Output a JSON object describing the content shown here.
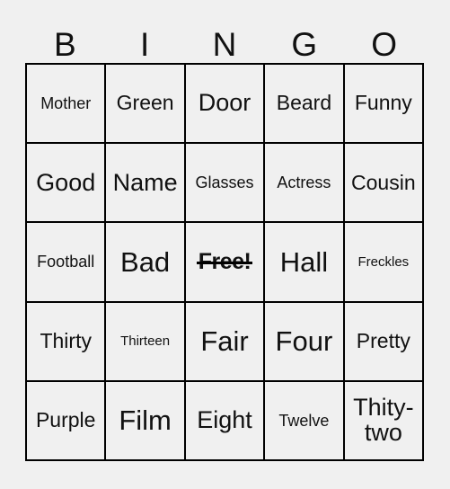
{
  "card": {
    "headers": [
      "B",
      "I",
      "N",
      "G",
      "O"
    ],
    "rows": [
      [
        {
          "label": "Mother",
          "size": "sm",
          "marked": false
        },
        {
          "label": "Green",
          "size": "md",
          "marked": false
        },
        {
          "label": "Door",
          "size": "lg",
          "marked": false
        },
        {
          "label": "Beard",
          "size": "md",
          "marked": false
        },
        {
          "label": "Funny",
          "size": "md",
          "marked": false
        }
      ],
      [
        {
          "label": "Good",
          "size": "lg",
          "marked": false
        },
        {
          "label": "Name",
          "size": "lg",
          "marked": false
        },
        {
          "label": "Glasses",
          "size": "sm",
          "marked": false
        },
        {
          "label": "Actress",
          "size": "sm",
          "marked": false
        },
        {
          "label": "Cousin",
          "size": "md",
          "marked": false
        }
      ],
      [
        {
          "label": "Football",
          "size": "sm",
          "marked": false
        },
        {
          "label": "Bad",
          "size": "xl",
          "marked": false
        },
        {
          "label": "Free!",
          "size": "free",
          "marked": true
        },
        {
          "label": "Hall",
          "size": "xl",
          "marked": false
        },
        {
          "label": "Freckles",
          "size": "xs",
          "marked": false
        }
      ],
      [
        {
          "label": "Thirty",
          "size": "md",
          "marked": false
        },
        {
          "label": "Thirteen",
          "size": "xs",
          "marked": false
        },
        {
          "label": "Fair",
          "size": "xl",
          "marked": false
        },
        {
          "label": "Four",
          "size": "xl",
          "marked": false
        },
        {
          "label": "Pretty",
          "size": "md",
          "marked": false
        }
      ],
      [
        {
          "label": "Purple",
          "size": "md",
          "marked": false
        },
        {
          "label": "Film",
          "size": "xl",
          "marked": false
        },
        {
          "label": "Eight",
          "size": "lg",
          "marked": false
        },
        {
          "label": "Twelve",
          "size": "sm",
          "marked": false
        },
        {
          "label": "Thity-two",
          "size": "lg",
          "marked": false,
          "wrap": true
        }
      ]
    ]
  },
  "colors": {
    "background": "#f0f0f0",
    "border": "#000000",
    "text": "#111111"
  }
}
